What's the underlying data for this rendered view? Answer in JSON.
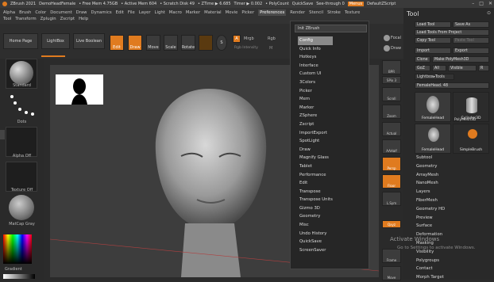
{
  "titlebar": {
    "app": "ZBrush 2021",
    "doc": "DemoHeadFemale",
    "free_mem": "• Free Mem 4.75GB",
    "active_mem": "• Active Mem 604",
    "scratch": "• Scratch Disk 49",
    "ztime": "• ZTime ▶ 6.685",
    "timer": "Timer ▶ 0.002",
    "polycount": "• PolyCount",
    "quicksave": "QuickSave",
    "seethrough": "See-through  0",
    "menus": "Menus",
    "script": "DefaultZScript"
  },
  "menubar": {
    "row1": [
      "Alpha",
      "Brush",
      "Color",
      "Document",
      "Draw",
      "Dynamics",
      "Edit",
      "File",
      "Layer",
      "Light",
      "Macro",
      "Marker",
      "Material",
      "Movie",
      "Picker",
      "Preferences",
      "Render",
      "Stencil",
      "Stroke",
      "Texture"
    ],
    "row2": [
      "Tool",
      "Transform",
      "Zplugin",
      "Zscript",
      "Help"
    ],
    "active": "Preferences"
  },
  "toolbar": {
    "home": "Home Page",
    "lightbox": "LightBox",
    "live_boolean": "Live Boolean",
    "edit": "Edit",
    "draw": "Draw",
    "move": "Move",
    "scale": "Scale",
    "rotate": "Rotate",
    "a_btn": "A",
    "mrgb": "Mrgb",
    "rgb": "Rgb",
    "rgb_intensity": "Rgb Intensity",
    "m": "M",
    "focal": "Focal",
    "draw_size": "Draw"
  },
  "leftshelf": {
    "standard": "Standard",
    "dots": "Dots",
    "alpha_off": "Alpha Off",
    "texture_off": "Texture Off",
    "matcap": "MatCap Gray",
    "gradient": "Gradient"
  },
  "rightshelf": {
    "bpr": "BPR",
    "spix": "SPix 3",
    "scroll": "Scroll",
    "zoom": "Zoom",
    "actual": "Actual",
    "aahalf": "AAHalf",
    "persp": "Persp",
    "floor": "Floor",
    "lsym": "L.Sym",
    "gxyz": "Qxyz",
    "frame": "Frame",
    "move": "Move"
  },
  "dropdown": {
    "input": "Init ZBrush",
    "items": [
      "Config",
      "Quick Info",
      "Hotkeys",
      "Interface",
      "Custom UI",
      "3Colors",
      "Picker",
      "Mem",
      "Marker",
      "ZSphere",
      "Zscript",
      "ImportExport",
      "SpotLight",
      "Draw",
      "Magnify Glass",
      "Tablet",
      "Performance",
      "Edit",
      "Transpose",
      "Transpose Units",
      "Gizmo 3D",
      "Geometry",
      "Misc",
      "Undo History",
      "QuickSave",
      "ScreenSaver"
    ],
    "highlighted": "Config"
  },
  "toolpanel": {
    "title": "Tool",
    "load_tool": "Load Tool",
    "save_as": "Save As",
    "load_from_project": "Load Tools From Project",
    "copy_tool": "Copy Tool",
    "paste_tool": "Paste Tool",
    "import": "Import",
    "export": "Export",
    "clone": "Clone",
    "make_polymesh": "Make PolyMesh3D",
    "goz": "GoZ",
    "all": "All",
    "visible": "Visible",
    "r": "R",
    "lightbox_tools": "Lightbox▸Tools",
    "femalehead": "FemaleHead. 48",
    "thumbs": [
      "FemaleHead",
      "Cylinder3D",
      "FemaleHead",
      "SimpleBrush"
    ],
    "poly": "PolyMesh3D",
    "list": [
      "Subtool",
      "Geometry",
      "ArrayMesh",
      "NanoMesh",
      "Layers",
      "FiberMesh",
      "Geometry HD",
      "Preview",
      "Surface",
      "Deformation",
      "Masking",
      "Visibility",
      "Polygroups",
      "Contact",
      "Morph Target"
    ]
  },
  "watermark": {
    "line1": "Activate Windows",
    "line2": "Go to Settings to activate Windows."
  },
  "colors": {
    "accent": "#e07b1f",
    "background": "#2b2b2b",
    "viewport": "#3d3d3d"
  }
}
